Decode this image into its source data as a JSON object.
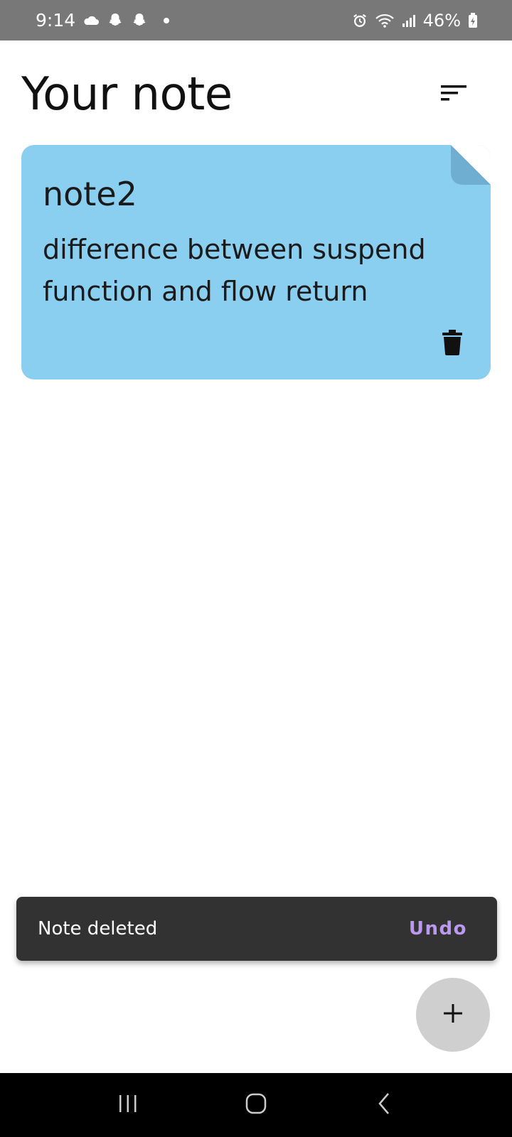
{
  "status_bar": {
    "time": "9:14",
    "battery": "46%",
    "icons": [
      "cloud-icon",
      "snapchat-icon",
      "snapchat-icon",
      "dot-icon",
      "alarm-icon",
      "wifi-icon",
      "signal-icon",
      "battery-icon"
    ]
  },
  "header": {
    "title": "Your note",
    "sort_icon": "sort-icon"
  },
  "notes": [
    {
      "title": "note2",
      "body": "difference between suspend function and flow return",
      "color": "#8ACEF0",
      "delete_icon": "trash-icon"
    }
  ],
  "snackbar": {
    "message": "Note deleted",
    "action": "Undo",
    "action_color": "#BB99F0"
  },
  "fab": {
    "icon": "plus-icon"
  },
  "nav_bar": {
    "buttons": [
      "recents-icon",
      "home-icon",
      "back-icon"
    ]
  }
}
